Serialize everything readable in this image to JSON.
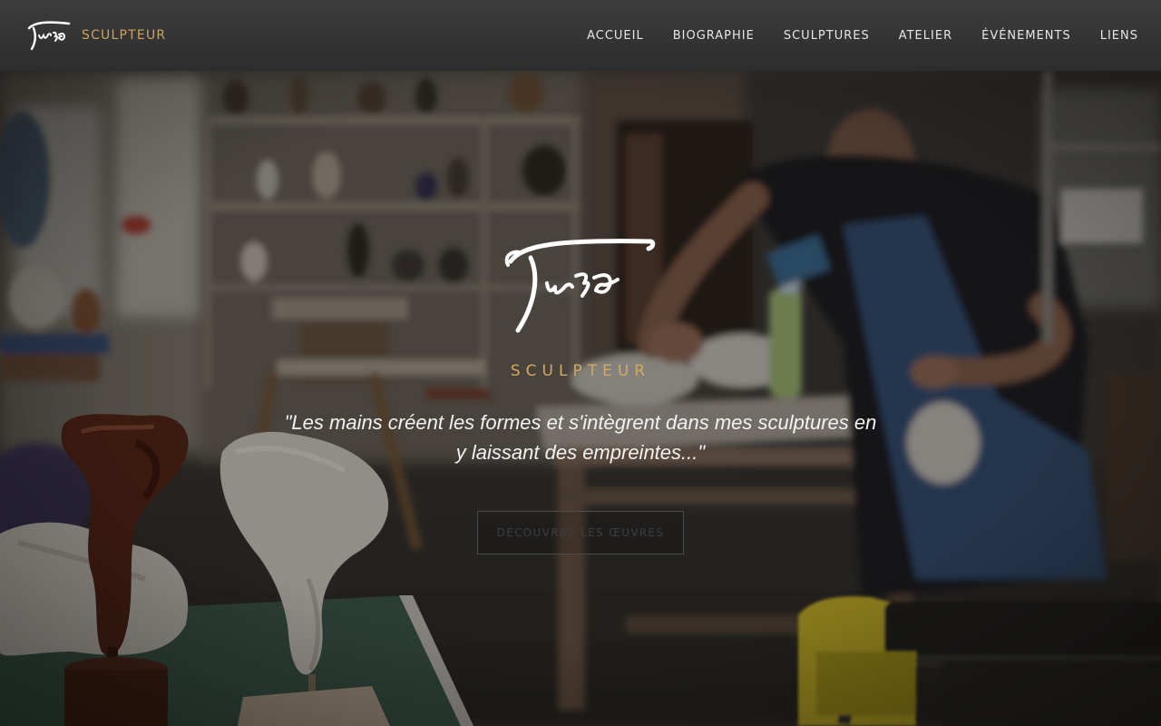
{
  "header": {
    "brand_label": "SCULPTEUR",
    "nav": [
      {
        "label": "ACCUEIL"
      },
      {
        "label": "BIOGRAPHIE"
      },
      {
        "label": "SCULPTURES"
      },
      {
        "label": "ATELIER"
      },
      {
        "label": "ÉVÉNEMENTS"
      },
      {
        "label": "LIENS"
      }
    ]
  },
  "hero": {
    "subtitle": "SCULPTEUR",
    "quote": "\"Les mains créent les formes et s'intègrent dans mes sculptures en y laissant des empreintes...\"",
    "cta_label": "DÉCOUVREZ LES ŒUVRES"
  },
  "colors": {
    "accent": "#d4a85e",
    "header_bg": "#333333",
    "text_light": "#f2f2f2"
  }
}
